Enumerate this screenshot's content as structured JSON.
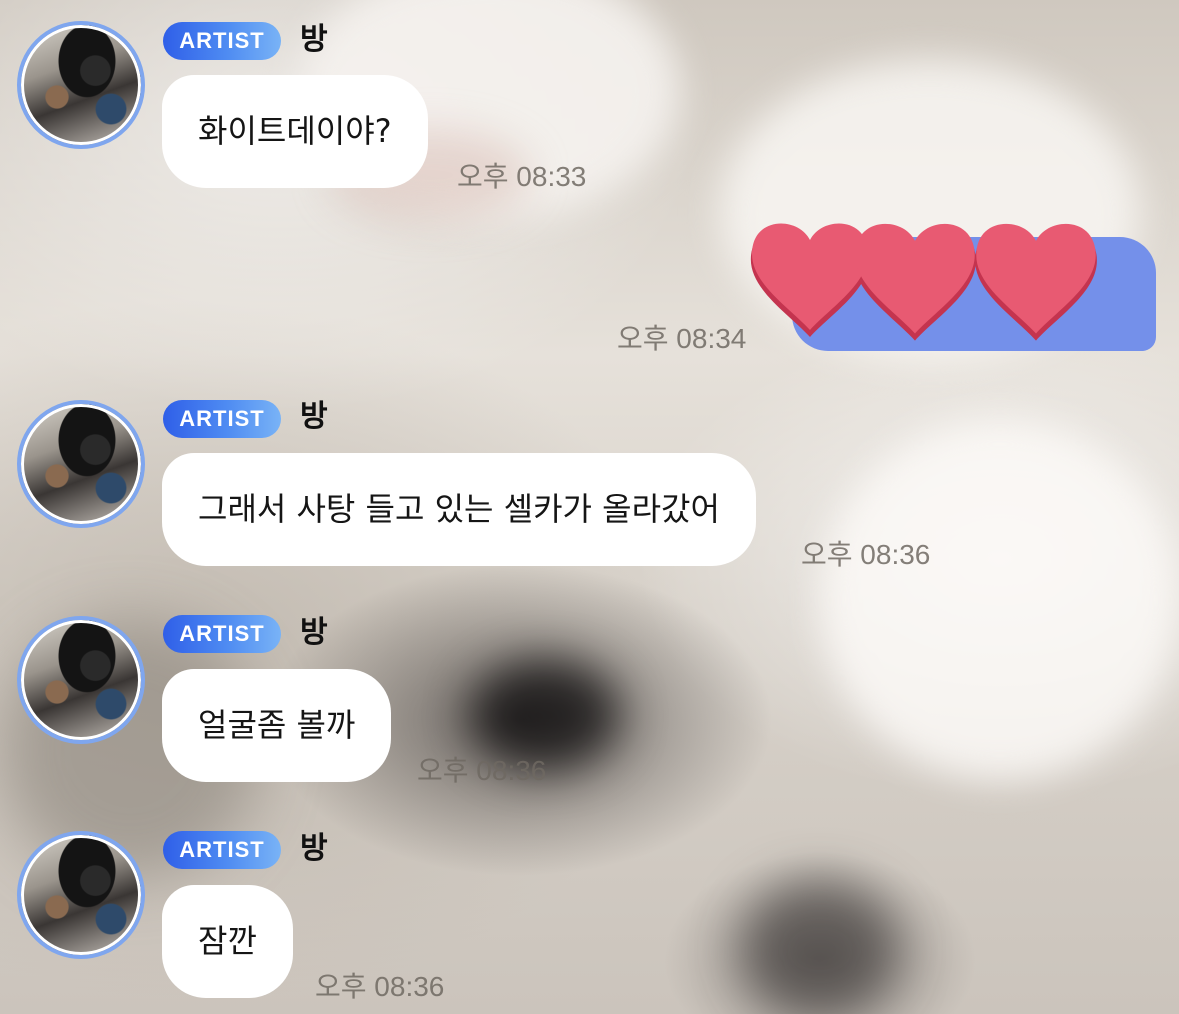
{
  "messages": [
    {
      "badge": "ARTIST",
      "sender": "방",
      "text": "화이트데이야?",
      "time": "오후 08:33"
    },
    {
      "badge": "ARTIST",
      "sender": "방",
      "text": "그래서 사탕 들고 있는 셀카가 올라갔어",
      "time": "오후 08:36"
    },
    {
      "badge": "ARTIST",
      "sender": "방",
      "text": "얼굴좀 볼까",
      "time": "오후 08:36"
    },
    {
      "badge": "ARTIST",
      "sender": "방",
      "text": "잠깐",
      "time": "오후 08:36"
    }
  ],
  "my_reply": {
    "time": "오후 08:34",
    "content_icon": "red-hearts-sticker"
  },
  "colors": {
    "badge_gradient_start": "#2f5fe8",
    "badge_gradient_end": "#79b3f6",
    "my_bubble": "#7490ea",
    "heart": "#e85a72",
    "avatar_ring": "#7fa6ee"
  }
}
